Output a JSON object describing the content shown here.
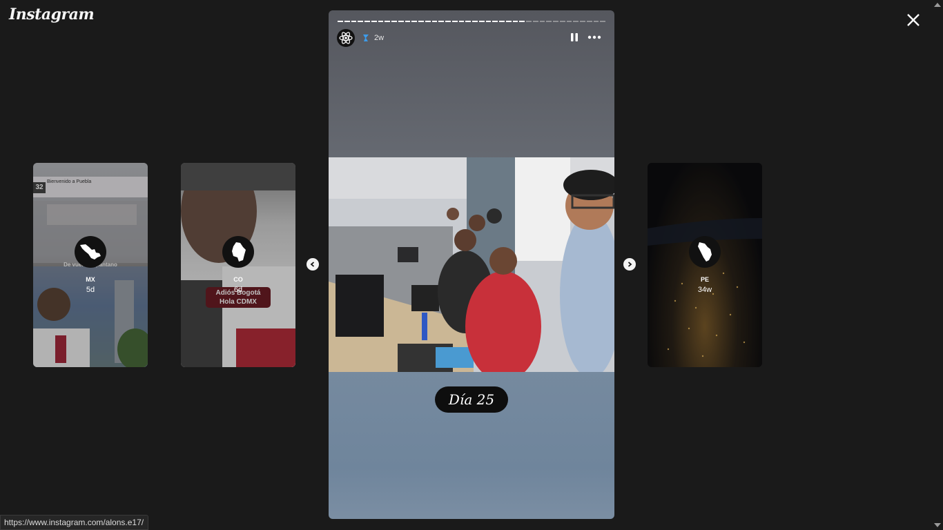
{
  "app": {
    "logo_text": "Instagram"
  },
  "close": {
    "icon": "close-icon"
  },
  "previews": [
    {
      "username": "MX",
      "time": "5d",
      "caption": "De vuelta al pantano",
      "sign": "Bienvenido a Puebla",
      "sign_number": "32"
    },
    {
      "username": "CO",
      "time": "6d",
      "banner_line1": "Adiós Bogotá",
      "banner_line2": "Hola CDMX"
    },
    {
      "username": "PE",
      "time": "34w"
    }
  ],
  "story": {
    "time": "2w",
    "progress": {
      "segments": 40,
      "current": 28
    },
    "caption": "Día 25",
    "pause_icon": "pause-icon",
    "more_icon": "more-options-icon"
  },
  "navigation": {
    "prev_icon": "chevron-left-icon",
    "next_icon": "chevron-right-icon"
  },
  "status_bar": {
    "url": "https://www.instagram.com/alons.e17/"
  }
}
